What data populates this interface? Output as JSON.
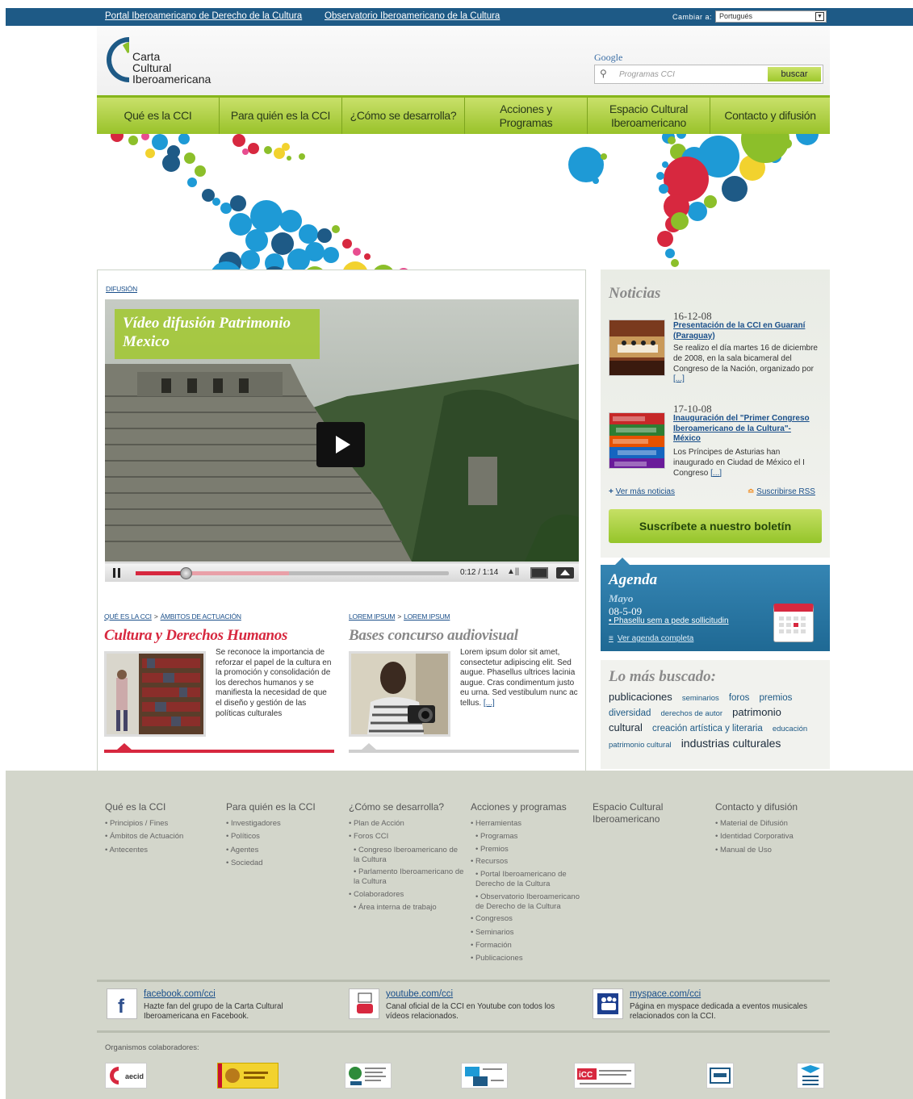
{
  "topbar": {
    "link1": "Portal Iberoamericano de Derecho de la Cultura",
    "link2": "Observatorio Iberoamericano de la Cultura",
    "lang_label": "Cambiar a:",
    "lang_value": "Portugués"
  },
  "header": {
    "logo_line1": "Carta",
    "logo_line2": "Cultural",
    "logo_line3": "Iberoamericana",
    "google": "Google",
    "search_placeholder": "Programas CCI",
    "search_button": "buscar"
  },
  "nav": [
    {
      "label": "Qué es la CCI"
    },
    {
      "label": "Para quién es la CCI"
    },
    {
      "label": "¿Cómo se desarrolla?"
    },
    {
      "label": "Acciones y Programas"
    },
    {
      "label": "Espacio Cultural Iberoamericano"
    },
    {
      "label": "Contacto y difusión"
    }
  ],
  "main": {
    "section_tag": "DIFUSIÓN",
    "video": {
      "title": "Vídeo difusión Patrimonio Mexico",
      "time": "0:12 / 1:14",
      "progress": 0.16,
      "buffered": 0.49
    },
    "col1": {
      "crumb1": "QUÉ ES LA CCI",
      "crumb_sep": ">",
      "crumb2": "ÁMBITOS DE ACTUACIÓN",
      "title": "Cultura y Derechos Humanos",
      "text": "Se reconoce la importancia de reforzar el papel de la cultura en la promoción y consolidación de los derechos humanos y se manifiesta la necesidad de que el diseño y gestión de las políticas culturales",
      "accent": "#d7283f"
    },
    "col2": {
      "crumb1": "LOREM IPSUM",
      "crumb_sep": ">",
      "crumb2": "LOREM IPSUM",
      "title": "Bases concurso audiovisual",
      "text": "Lorem ipsum dolor sit amet, consectetur adipiscing elit. Sed augue. Phasellus ultrices lacinia augue. Cras condimentum justo eu urna. Sed vestibulum nunc ac tellus.",
      "more": "[...]",
      "accent": "#cfcfcf"
    }
  },
  "news": {
    "title": "Noticias",
    "items": [
      {
        "date": "16-12-08",
        "title": "Presentación de la CCI en Guaraní (Paraguay)",
        "body": "Se realizo el día martes 16 de diciembre de 2008, en la sala bicameral del Congreso de la Nación, organizado por",
        "more": "[...]"
      },
      {
        "date": "17-10-08",
        "title": "Inauguración del \"Primer Congreso Iberoamericano de la Cultura\"- México",
        "body": "Los Príncipes de Asturias han inaugurado en Ciudad de México el I Congreso",
        "more": "[...]"
      }
    ],
    "more_link": "Ver más noticias",
    "rss_link": "Suscribirse RSS",
    "newsletter": "Suscríbete a nuestro boletín"
  },
  "agenda": {
    "title": "Agenda",
    "month": "Mayo",
    "day": "08-5-09",
    "event": "Phasellu sem a pede sollicitudin",
    "all_link": "Ver agenda completa"
  },
  "most_searched": {
    "title": "Lo más buscado:",
    "tags": [
      {
        "text": "publicaciones",
        "size": 13
      },
      {
        "text": "seminarios",
        "size": 9.5
      },
      {
        "text": "foros",
        "size": 11.5
      },
      {
        "text": "premios",
        "size": 11.5
      },
      {
        "text": "diversidad",
        "size": 11.5
      },
      {
        "text": "derechos de autor",
        "size": 9.5
      },
      {
        "text": "patrimonio cultural",
        "size": 13
      },
      {
        "text": "creación artística y literaria",
        "size": 11.5
      },
      {
        "text": "educación",
        "size": 9.5
      },
      {
        "text": "patrimonio cultural",
        "size": 9.5
      },
      {
        "text": "industrias culturales",
        "size": 14
      }
    ]
  },
  "footer": {
    "columns": [
      {
        "title": "Qué es la CCI",
        "items": [
          {
            "t": "Principios / Fines"
          },
          {
            "t": "Ámbitos de Actuación"
          },
          {
            "t": "Antecentes"
          }
        ]
      },
      {
        "title": "Para quién es la CCI",
        "items": [
          {
            "t": "Investigadores"
          },
          {
            "t": "Políticos"
          },
          {
            "t": "Agentes"
          },
          {
            "t": "Sociedad"
          }
        ]
      },
      {
        "title": "¿Cómo se desarrolla?",
        "items": [
          {
            "t": "Plan de Acción"
          },
          {
            "t": "Foros CCI"
          },
          {
            "t": "Congreso Iberoamericano de la Cultura",
            "sub": true
          },
          {
            "t": "Parlamento Iberoamericano de la Cultura",
            "sub": true
          },
          {
            "t": "Colaboradores"
          },
          {
            "t": "Área interna de trabajo",
            "sub": true
          }
        ]
      },
      {
        "title": "Acciones y programas",
        "items": [
          {
            "t": "Herramientas"
          },
          {
            "t": "Programas",
            "sub": true
          },
          {
            "t": "Premios",
            "sub": true
          },
          {
            "t": "Recursos"
          },
          {
            "t": "Portal Iberoamericano de Derecho de la Cultura",
            "sub": true
          },
          {
            "t": "Observatorio Iberoamericano de Derecho de la Cultura",
            "sub": true
          },
          {
            "t": "Congresos"
          },
          {
            "t": "Seminarios"
          },
          {
            "t": "Formación"
          },
          {
            "t": "Publicaciones"
          }
        ]
      },
      {
        "title": "Espacio Cultural Iberoamericano",
        "items": []
      },
      {
        "title": "Contacto y difusión",
        "items": [
          {
            "t": "Material de Difusión"
          },
          {
            "t": "Identidad Corporativa"
          },
          {
            "t": "Manual de Uso"
          }
        ]
      }
    ],
    "social": [
      {
        "icon": "facebook-icon",
        "name": "facebook.com/cci",
        "desc": "Hazte fan del grupo de la Carta Cultural Iberoamericana en Facebook."
      },
      {
        "icon": "youtube-icon",
        "name": "youtube.com/cci",
        "desc": "Canal oficial de la CCI en Youtube con todos los vídeos relacionados."
      },
      {
        "icon": "myspace-icon",
        "name": "myspace.com/cci",
        "desc": "Página en myspace dedicada a eventos musicales relacionados con la CCI."
      }
    ],
    "orgs_label": "Organismos colaboradores:",
    "orgs": [
      "aecid",
      "Ministerio de Cultura",
      "OEI",
      "Secretaría General Iberoamericana",
      "Centro Andrés Bello",
      "CERLALC",
      "Convenio Andrés Bello"
    ]
  },
  "colors": {
    "topbar": "#1e5a86",
    "nav_green": "#99c22a",
    "accent_red": "#d7283f",
    "link_blue": "#1a4f8a",
    "footer_bg": "#d3d6cb"
  }
}
